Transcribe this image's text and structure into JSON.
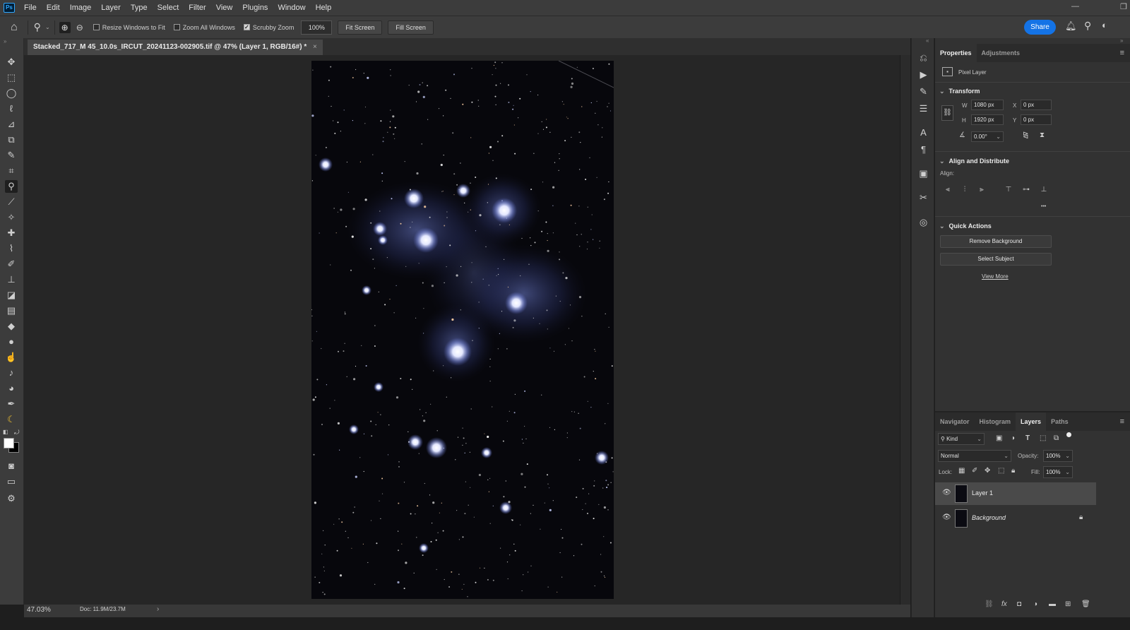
{
  "app": {
    "logo_text": "Ps"
  },
  "menu": [
    "File",
    "Edit",
    "Image",
    "Layer",
    "Type",
    "Select",
    "Filter",
    "View",
    "Plugins",
    "Window",
    "Help"
  ],
  "options_bar": {
    "resize_windows": "Resize Windows to Fit",
    "zoom_all": "Zoom All Windows",
    "scrubby_zoom": "Scrubby Zoom",
    "zoom_value": "100%",
    "fit_screen": "Fit Screen",
    "fill_screen": "Fill Screen",
    "share": "Share"
  },
  "document": {
    "tab_title": "Stacked_717_M 45_10.0s_IRCUT_20241123-002905.tif @ 47% (Layer 1, RGB/16#) *",
    "close": "×"
  },
  "status": {
    "zoom": "47.03%",
    "doc": "Doc: 11.9M/23.7M",
    "arrow": "›"
  },
  "properties_panel": {
    "tabs": [
      "Properties",
      "Adjustments"
    ],
    "pixel_layer": "Pixel Layer",
    "transform_title": "Transform",
    "w_label": "W",
    "w_value": "1080 px",
    "h_label": "H",
    "h_value": "1920 px",
    "x_label": "X",
    "x_value": "0 px",
    "y_label": "Y",
    "y_value": "0 px",
    "angle_value": "0.00°",
    "align_title": "Align and Distribute",
    "align_label": "Align:",
    "more": "•••",
    "quick_title": "Quick Actions",
    "remove_bg": "Remove Background",
    "select_subject": "Select Subject",
    "view_more": "View More"
  },
  "layers_panel": {
    "tabs": [
      "Navigator",
      "Histogram",
      "Layers",
      "Paths"
    ],
    "kind": "Kind",
    "blend_mode": "Normal",
    "opacity_label": "Opacity:",
    "opacity_value": "100%",
    "lock_label": "Lock:",
    "fill_label": "Fill:",
    "fill_value": "100%",
    "layers": [
      "Layer 1",
      "Background"
    ]
  },
  "colors": {
    "accent": "#1473e6",
    "panel": "#323232",
    "canvas_bg": "#262626"
  }
}
